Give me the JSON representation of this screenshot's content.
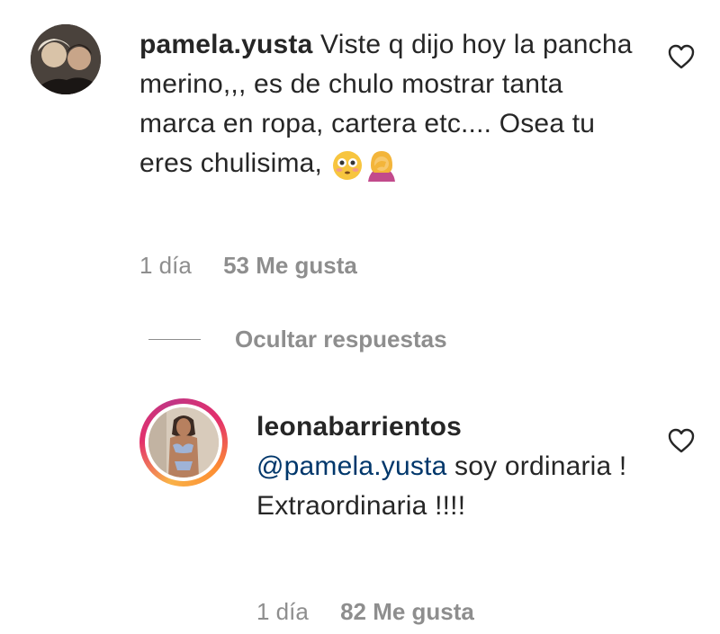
{
  "comments": [
    {
      "username": "pamela.yusta",
      "text": "Viste q dijo hoy la pancha merino,,, es de chulo mostrar tanta marca en ropa, cartera etc.... Osea tu eres chulisima,",
      "emojis": [
        "flushed-face",
        "person-facepalming"
      ],
      "age": "1 día",
      "likes": "53 Me gusta"
    },
    {
      "username": "leonabarrientos",
      "mention": "@pamela.yusta",
      "text": "soy ordinaria ! Extraordinaria !!!!",
      "age": "1 día",
      "likes": "82 Me gusta"
    }
  ],
  "replies_toggle": "Ocultar respuestas",
  "colors": {
    "text": "#262626",
    "secondary": "#8e8e8e",
    "mention": "#00376b"
  },
  "icons": [
    "heart-outline-icon",
    "story-ring"
  ]
}
